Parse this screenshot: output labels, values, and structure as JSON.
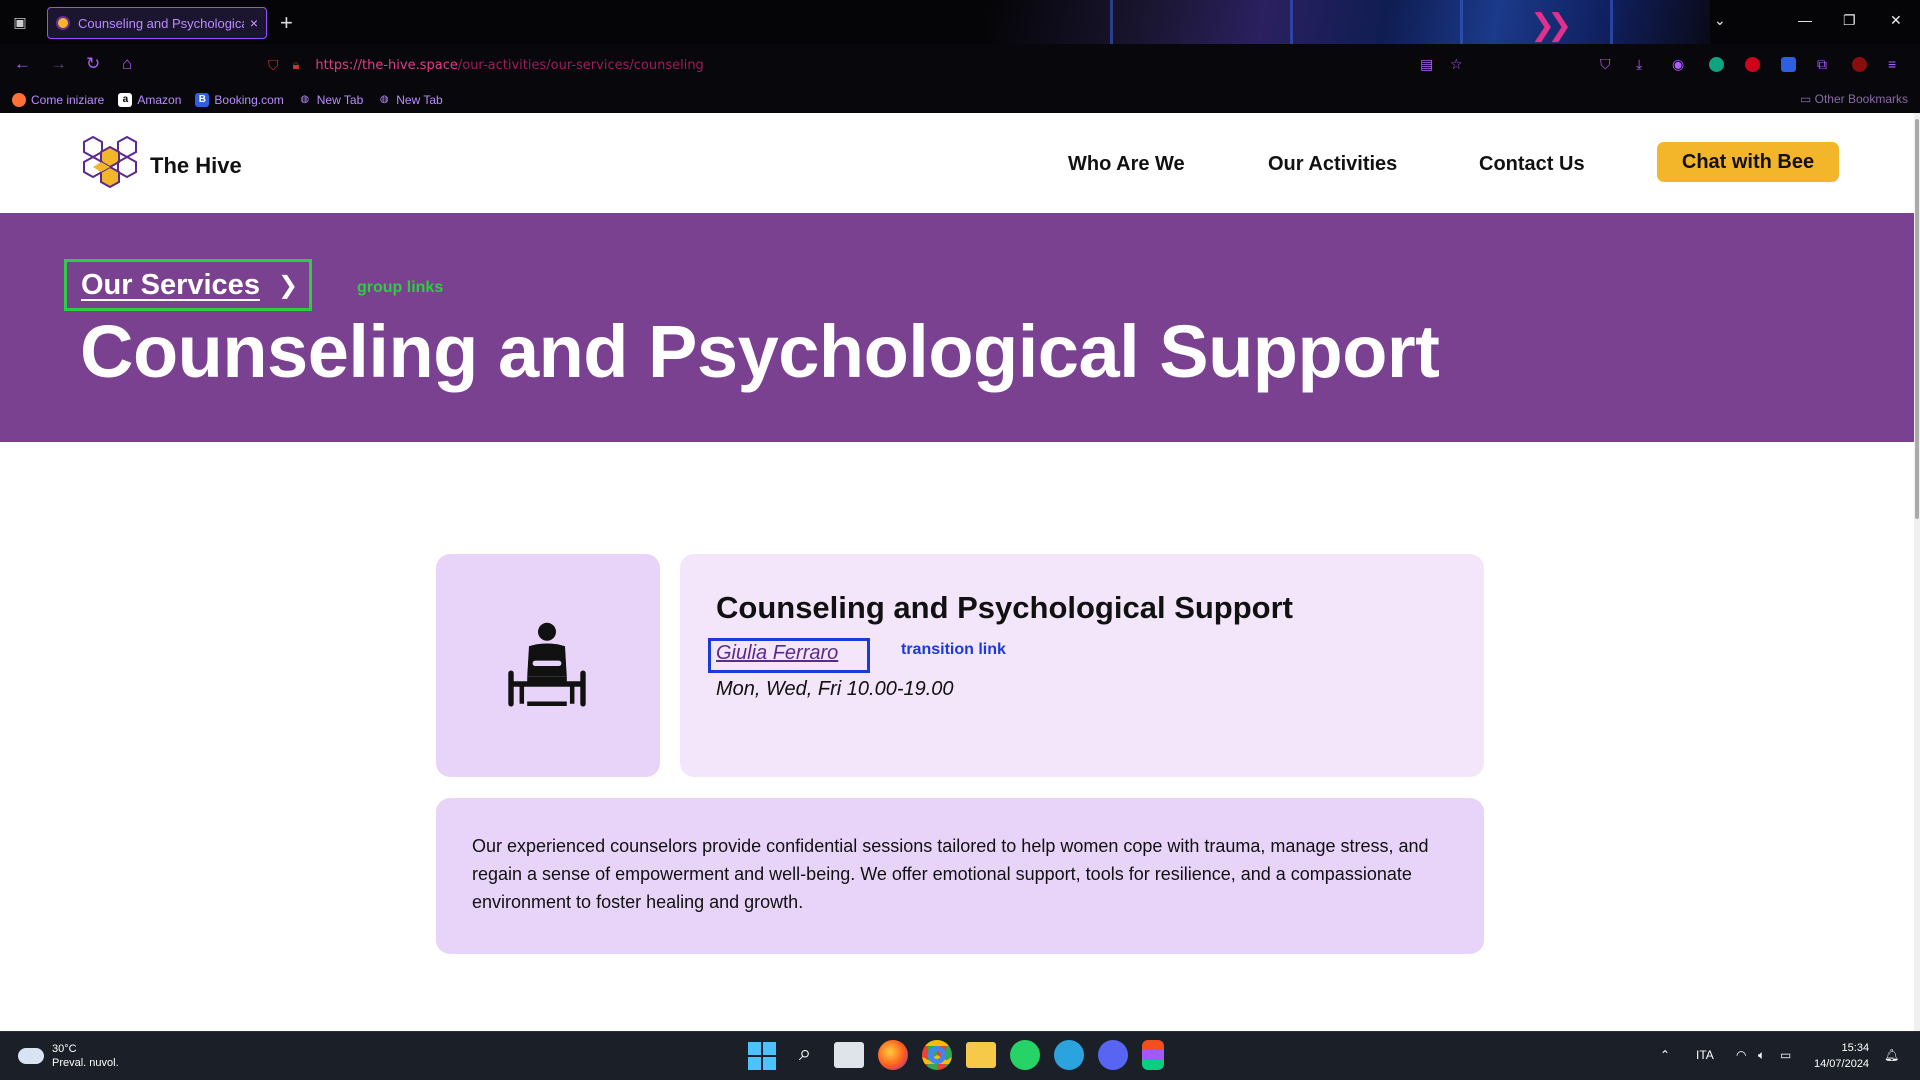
{
  "browser": {
    "tab_title": "Counseling and Psychological Su",
    "tab_close": "×",
    "new_tab": "+",
    "url_host": "https://the-hive.space",
    "url_path": "/our-activities/our-services/counseling",
    "bookmarks": [
      {
        "label": "Come iniziare",
        "icon": "firefox-icon",
        "color": "#ff7139"
      },
      {
        "label": "Amazon",
        "icon": "amazon-icon",
        "color": "#ffffff"
      },
      {
        "label": "Booking.com",
        "icon": "booking-icon",
        "color": "#2d5fe0"
      },
      {
        "label": "New Tab",
        "icon": "globe-icon",
        "color": ""
      },
      {
        "label": "New Tab",
        "icon": "globe-icon",
        "color": ""
      }
    ],
    "other_bookmarks": "Other Bookmarks"
  },
  "site": {
    "brand": "The Hive",
    "nav": [
      "Who Are We",
      "Our Activities",
      "Contact Us"
    ],
    "cta": "Chat with Bee",
    "colors": {
      "purple": "#7a4191",
      "accent": "#f3b62b",
      "card": "#e8d4f8",
      "card_light": "#f3e6fb"
    }
  },
  "hero": {
    "breadcrumb": "Our Services",
    "annotation": "group links",
    "title": "Counseling and Psychological Support"
  },
  "service": {
    "icon": "counseling-person-icon",
    "title": "Counseling and Psychological Support",
    "person": "Giulia Ferraro",
    "annotation": "transition link",
    "hours": "Mon, Wed, Fri 10.00-19.00",
    "description": "Our experienced counselors provide confidential sessions tailored to help women cope with trauma, manage stress, and regain a sense of empowerment and well-being. We offer emotional support, tools for resilience, and a compassionate environment to foster healing and growth."
  },
  "taskbar": {
    "temp": "30°C",
    "weather": "Preval. nuvol.",
    "lang": "ITA",
    "time": "15:34",
    "date": "14/07/2024"
  }
}
